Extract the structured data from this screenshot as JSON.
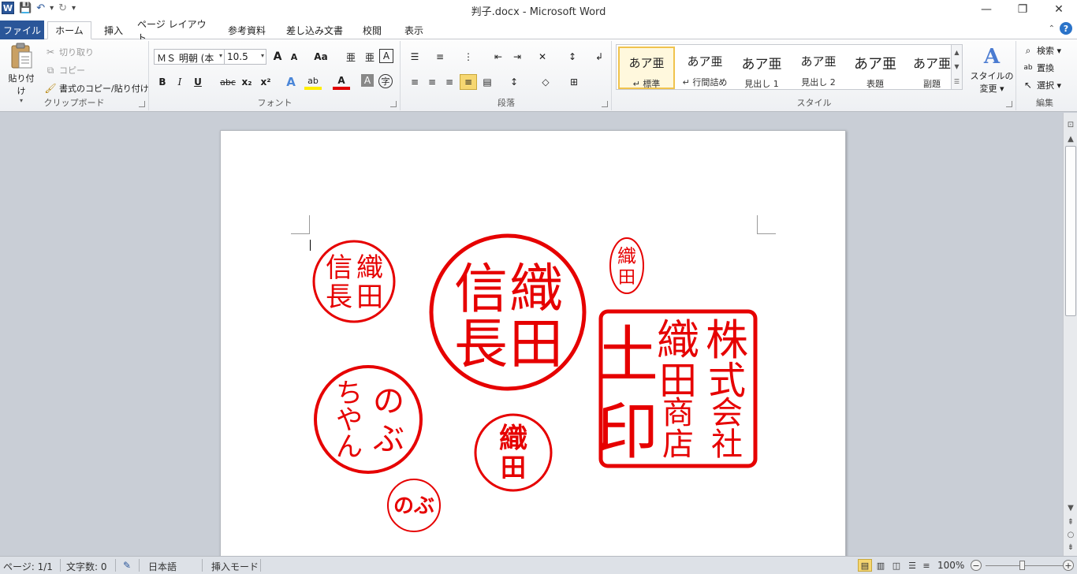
{
  "window": {
    "title": "判子.docx  -  Microsoft Word",
    "app_icon": "W",
    "minimize": "—",
    "restore": "❐",
    "close": "✕"
  },
  "quick_access": {
    "save_icon": "💾",
    "undo_icon": "↶",
    "redo_icon": "↻",
    "customize_icon": "▾"
  },
  "tabs": [
    {
      "label": "ファイル"
    },
    {
      "label": "ホーム"
    },
    {
      "label": "挿入"
    },
    {
      "label": "ページ レイアウト"
    },
    {
      "label": "参考資料"
    },
    {
      "label": "差し込み文書"
    },
    {
      "label": "校閲"
    },
    {
      "label": "表示"
    }
  ],
  "ribbon": {
    "clipboard": {
      "label": "クリップボード",
      "paste": "貼り付け",
      "cut": "切り取り",
      "copy": "コピー",
      "format_painter": "書式のコピー/貼り付け"
    },
    "font": {
      "label": "フォント",
      "font_name": "ＭＳ 明朝 (本",
      "font_size": "10.5",
      "grow": "A",
      "shrink": "A",
      "change_case": "Aa",
      "phonetic": "亜",
      "furigana": "亜",
      "char_border": "A",
      "bold": "B",
      "italic": "I",
      "underline": "U",
      "strike": "abc",
      "subscript": "x₂",
      "superscript": "x²",
      "text_effects": "A",
      "highlight": "ab",
      "font_color": "A",
      "char_shading": "A",
      "enclose": "字"
    },
    "paragraph": {
      "label": "段落"
    },
    "styles": {
      "label": "スタイル",
      "items": [
        {
          "sample": "あア亜",
          "name": "↵ 標準"
        },
        {
          "sample": "あア亜",
          "name": "↵ 行間詰め"
        },
        {
          "sample": "あア亜",
          "name": "見出し 1"
        },
        {
          "sample": "あア亜",
          "name": "見出し 2"
        },
        {
          "sample": "あア亜",
          "name": "表題"
        },
        {
          "sample": "あア亜",
          "name": "副題"
        }
      ],
      "change_styles_1": "スタイルの",
      "change_styles_2": "変更 ▾"
    },
    "editing": {
      "label": "編集",
      "find": "検索 ▾",
      "replace": "置換",
      "select": "選択 ▾"
    }
  },
  "seals": {
    "seal1": [
      "信",
      "長",
      "織",
      "田"
    ],
    "seal2": [
      "信",
      "長",
      "織",
      "田"
    ],
    "seal3": [
      "織",
      "田"
    ],
    "seal4": [
      "土",
      "印",
      "織",
      "田",
      "商",
      "店",
      "株",
      "式",
      "会",
      "社"
    ],
    "seal5": [
      "ち",
      "や",
      "ん",
      "の",
      "ぶ"
    ],
    "seal6": [
      "織",
      "田"
    ],
    "seal7": [
      "のぶ"
    ]
  },
  "statusbar": {
    "page": "ページ: 1/1",
    "words": "文字数: 0",
    "language": "日本語",
    "mode": "挿入モード",
    "zoom": "100%"
  },
  "colors": {
    "seal_red": "#e60000",
    "file_tab": "#2a5699"
  }
}
